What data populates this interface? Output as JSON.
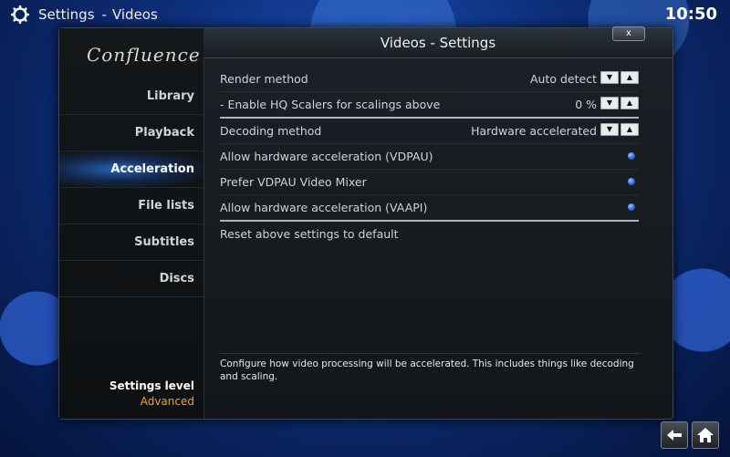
{
  "topbar": {
    "section": "Settings",
    "separator": "-",
    "page": "Videos",
    "time": "10:50"
  },
  "sidebar": {
    "logo": "Confluence",
    "items": [
      {
        "label": "Library"
      },
      {
        "label": "Playback"
      },
      {
        "label": "Acceleration"
      },
      {
        "label": "File lists"
      },
      {
        "label": "Subtitles"
      },
      {
        "label": "Discs"
      }
    ],
    "active_index": 2,
    "settings_level_label": "Settings level",
    "settings_level_value": "Advanced"
  },
  "content": {
    "title": "Videos - Settings",
    "close_label": "x",
    "rows": [
      {
        "label": "Render method",
        "value": "Auto detect",
        "control": "spinner"
      },
      {
        "label": "- Enable HQ Scalers for scalings above",
        "value": "0 %",
        "control": "spinner"
      },
      {
        "label": "Decoding method",
        "value": "Hardware accelerated",
        "control": "spinner"
      },
      {
        "label": "Allow hardware acceleration (VDPAU)",
        "control": "radio"
      },
      {
        "label": "Prefer VDPAU Video Mixer",
        "control": "radio"
      },
      {
        "label": "Allow hardware acceleration (VAAPI)",
        "control": "radio"
      },
      {
        "label": "Reset above settings to default",
        "control": "action"
      }
    ],
    "description": "Configure how video processing will be accelerated. This includes things like decoding and scaling."
  },
  "bottombar": {
    "back_icon": "back-arrow-icon",
    "home_icon": "home-icon"
  },
  "colors": {
    "accent": "#2a6ad8",
    "level_value": "#f0a02a"
  }
}
